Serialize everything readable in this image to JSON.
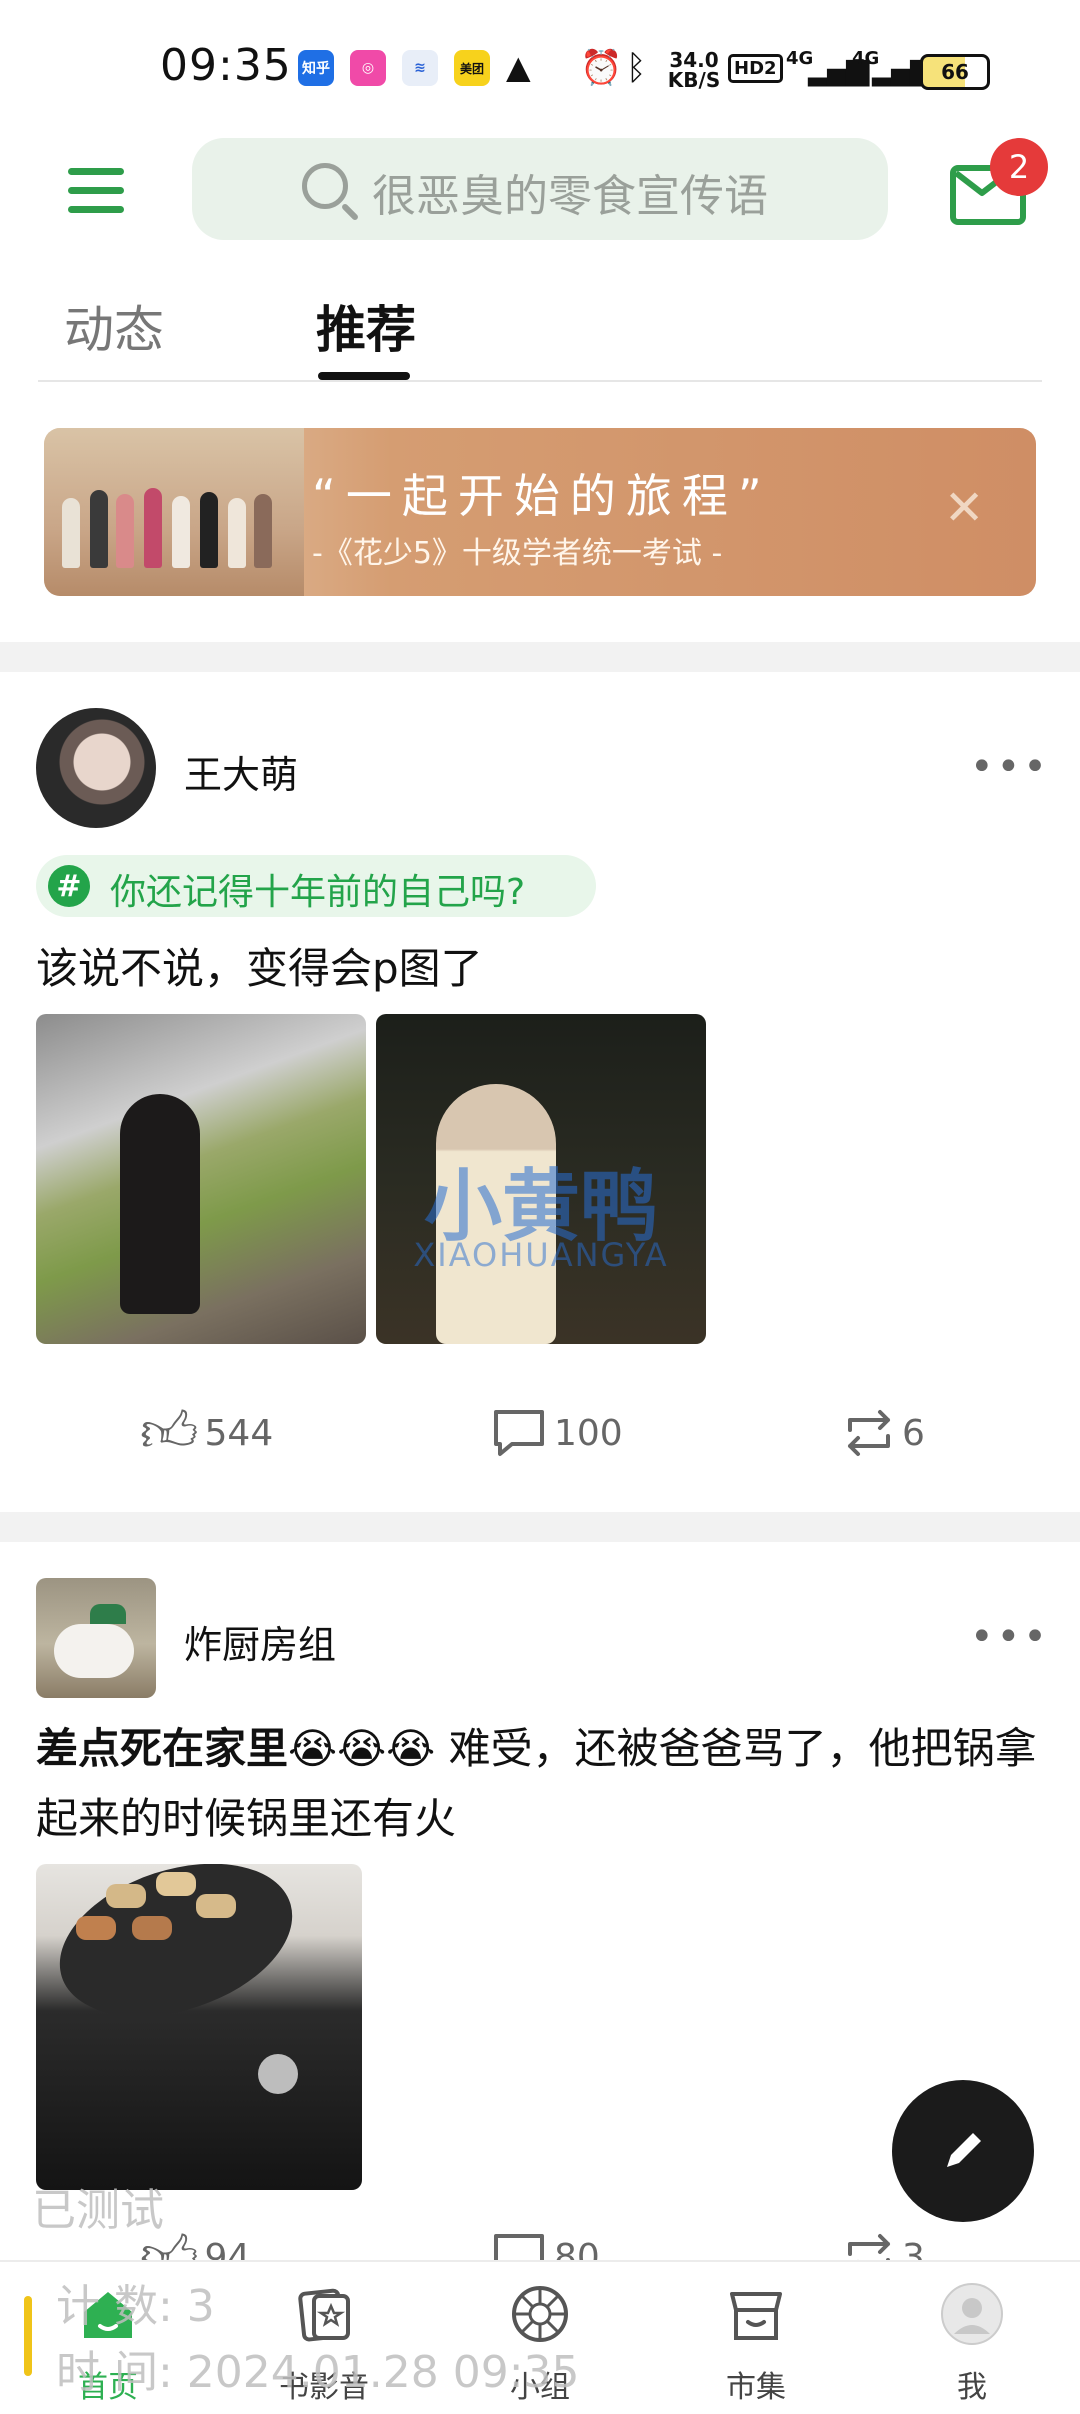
{
  "status_bar": {
    "time": "09:35",
    "apps": [
      "知乎",
      "美团"
    ],
    "net_speed": "34.0 KB/S",
    "hd": "HD2",
    "signal_1": "4G",
    "signal_2": "4G",
    "battery": "66"
  },
  "header": {
    "search_placeholder": "很恶臭的零食宣传语",
    "mail_badge": "2"
  },
  "tabs": [
    {
      "label": "动态",
      "active": false
    },
    {
      "label": "推荐",
      "active": true
    }
  ],
  "banner": {
    "title": "“一起开始的旅程”",
    "subtitle": "-《花少5》十级学者统一考试 -",
    "close": "✕"
  },
  "posts": [
    {
      "username": "王大萌",
      "more": "•••",
      "topic": "你还记得十年前的自己吗?",
      "text": "该说不说，变得会p图了",
      "image_watermark": "小黄鸭",
      "image_watermark_sub": "XIAOHUANGYA",
      "likes": "544",
      "comments": "100",
      "reposts": "6"
    },
    {
      "username": "炸厨房组",
      "more": "•••",
      "text_bold": "差点死在家里😭😭😭",
      "text_rest": " 难受，还被爸爸骂了，他把锅拿起来的时候锅里还有火",
      "likes": "94",
      "comments": "80",
      "reposts": "3"
    }
  ],
  "watermark": {
    "line1": "已测试",
    "line2": "计  数: 3",
    "line3": "时  间: 2024.01.28 09:35"
  },
  "bottom_nav": [
    {
      "label": "首页",
      "icon": "home-icon",
      "active": true
    },
    {
      "label": "书影音",
      "icon": "media-icon",
      "active": false
    },
    {
      "label": "小组",
      "icon": "group-icon",
      "active": false
    },
    {
      "label": "市集",
      "icon": "market-icon",
      "active": false
    },
    {
      "label": "我",
      "icon": "profile-icon",
      "active": false
    }
  ],
  "colors": {
    "brand_green": "#2e9d4a",
    "badge_red": "#e53a3a",
    "banner_orange": "#cf8e65"
  }
}
